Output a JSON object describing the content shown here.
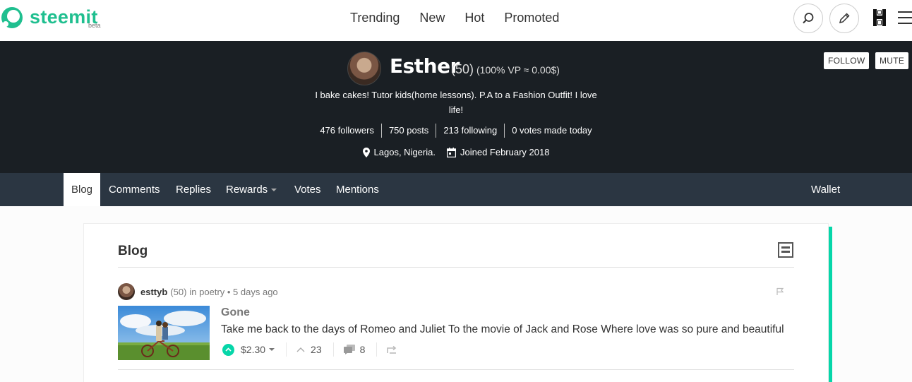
{
  "header": {
    "logo_text": "steemit",
    "logo_beta": "beta",
    "nav": [
      "Trending",
      "New",
      "Hot",
      "Promoted"
    ],
    "accent_color": "#1fbf8f"
  },
  "profile": {
    "name": "Esther",
    "reputation": "(50)",
    "vp": "(100% VP ≈ 0.00$)",
    "bio": "I bake cakes! Tutor kids(home lessons). P.A to a Fashion Outfit! I love life!",
    "stats": {
      "followers": "476 followers",
      "posts": "750 posts",
      "following": "213 following",
      "votes": "0 votes made today"
    },
    "location": "Lagos, Nigeria.",
    "joined": "Joined February 2018",
    "follow_label": "FOLLOW",
    "mute_label": "MUTE"
  },
  "tabs": {
    "blog": "Blog",
    "comments": "Comments",
    "replies": "Replies",
    "rewards": "Rewards",
    "votes": "Votes",
    "mentions": "Mentions",
    "wallet": "Wallet"
  },
  "content": {
    "section_title": "Blog",
    "post": {
      "author": "esttyb",
      "author_rep": "(50)",
      "category_prefix": "in poetry • 5 days ago",
      "title": "Gone",
      "body": "Take me back to the days of Romeo and Juliet To the movie of Jack and Rose Where love was so pure and beautiful",
      "payout": "$2.30",
      "votes": "23",
      "comments": "8"
    }
  }
}
